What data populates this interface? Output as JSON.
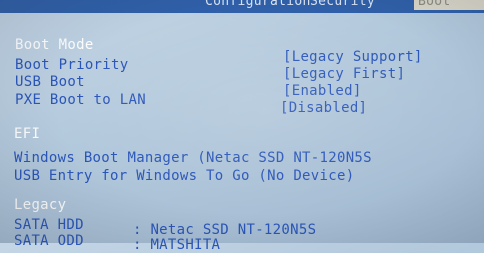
{
  "tabs": [
    "Configuration",
    "Security",
    "Boot"
  ],
  "settings": [
    {
      "label": "Boot Mode",
      "value": "[Legacy Support]"
    },
    {
      "label": "Boot Priority",
      "value": "[Legacy First]"
    },
    {
      "label": "USB Boot",
      "value": "[Enabled]"
    },
    {
      "label": "PXE Boot to LAN",
      "value": "[Disabled]"
    }
  ],
  "efi": {
    "heading": "EFI",
    "items": [
      "Windows Boot Manager (Netac SSD NT-120N5S",
      "USB Entry for Windows To Go (No Device)"
    ]
  },
  "legacy": {
    "heading": "Legacy",
    "items": [
      {
        "label": "SATA HDD",
        "value": ": Netac SSD NT-120N5S"
      },
      {
        "label": "SATA ODD",
        "value": ": MATSHITA"
      }
    ]
  },
  "colors": {
    "item": "#2a55b8",
    "selected": "#ffffff",
    "tab_bar": "#2f5fa8",
    "background": "#b3c9dc"
  }
}
